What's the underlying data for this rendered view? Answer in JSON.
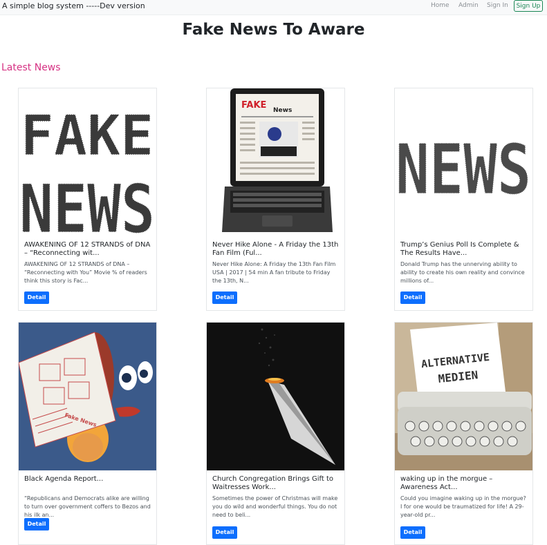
{
  "navbar": {
    "brand": "A simple blog system -----Dev version",
    "links": [
      "Home",
      "Admin",
      "Sign In"
    ],
    "signup": "Sign Up"
  },
  "page": {
    "title": "Fake News To Aware",
    "section": "Latest News"
  },
  "cards": [
    {
      "title": "AWAKENING OF 12 STRANDS of DNA – “Reconnecting wit...",
      "text": "AWAKENING OF 12 STRANDS of DNA – “Reconnecting with You” Movie % of readers think this story is Fac...",
      "button": "Detail",
      "image": "fake-news-word-art",
      "image_text": [
        "FAKE",
        "NEWS"
      ]
    },
    {
      "title": "Never Hike Alone - A Friday the 13th Fan Film (Ful...",
      "text": "Never Hike Alone: A Friday the 13th Fan Film USA | 2017 | 54 min A fan tribute to Friday the 13th, N...",
      "button": "Detail",
      "image": "laptop-fake-news",
      "image_text": [
        "FAKE",
        "News"
      ]
    },
    {
      "title": "Trump’s Genius Poll Is Complete & The Results Have...",
      "text": "Donald Trump has the unnerving ability to ability to create his own reality and convince millions of...",
      "button": "Detail",
      "image": "news-word-art",
      "image_text": [
        "NEWS"
      ]
    },
    {
      "title": "Black Agenda Report...",
      "text": "“Republicans and Democrats alike are willing to turn over government coffers to Bezos and his ilk an...",
      "button": "Detail",
      "image": "cartoon-fake-news",
      "image_text": [
        "Fake News"
      ]
    },
    {
      "title": "Church Congregation Brings Gift to Waitresses Work...",
      "text": "Sometimes the power of Christmas will make you do wild and wonderful things. You do not need to beli...",
      "button": "Detail",
      "image": "burning-paper-plane",
      "image_text": []
    },
    {
      "title": "waking up in the morgue – Awareness Act...",
      "text": "Could you imagine waking up in the morgue? I for one would be traumatized for life! A 29-year-old pr...",
      "button": "Detail",
      "image": "typewriter",
      "image_text": [
        "ALTERNATIVE",
        "MEDIEN"
      ]
    }
  ],
  "colors": {
    "accent": "#d63384",
    "button": "#0d6efd",
    "signup": "#198754"
  }
}
